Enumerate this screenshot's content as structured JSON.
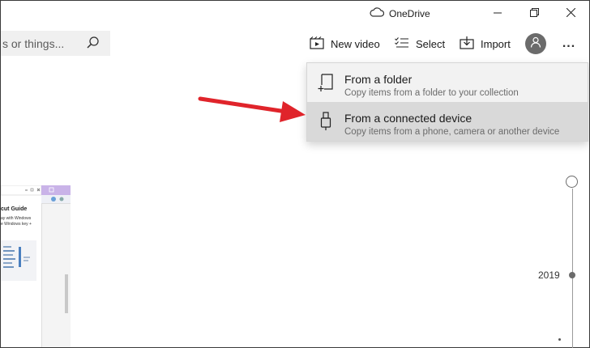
{
  "titlebar": {
    "app_name": "OneDrive",
    "icons": [
      "cloud-icon",
      "minimize-icon",
      "maximize-icon",
      "close-icon"
    ]
  },
  "search": {
    "value": "s or things...",
    "icon": "search-icon"
  },
  "toolbar": {
    "new_video_label": "New video",
    "select_label": "Select",
    "import_label": "Import",
    "more_label": "..."
  },
  "import_menu": {
    "items": [
      {
        "title": "From a folder",
        "subtitle": "Copy items from a folder to your collection",
        "icon": "folder-add-icon"
      },
      {
        "title": "From a connected device",
        "subtitle": "Copy items from a phone, camera or another device",
        "icon": "usb-device-icon"
      }
    ]
  },
  "thumbnail": {
    "heading": "cut Guide",
    "line1": "ay with Windows",
    "line2": "e Windows key +"
  },
  "timeline": {
    "year": "2019"
  },
  "colors": {
    "arrow": "#e0242b",
    "menu_bg": "#f2f2f2",
    "menu_hover": "#d9d9d9",
    "accent_purple": "#c9b3e8"
  }
}
